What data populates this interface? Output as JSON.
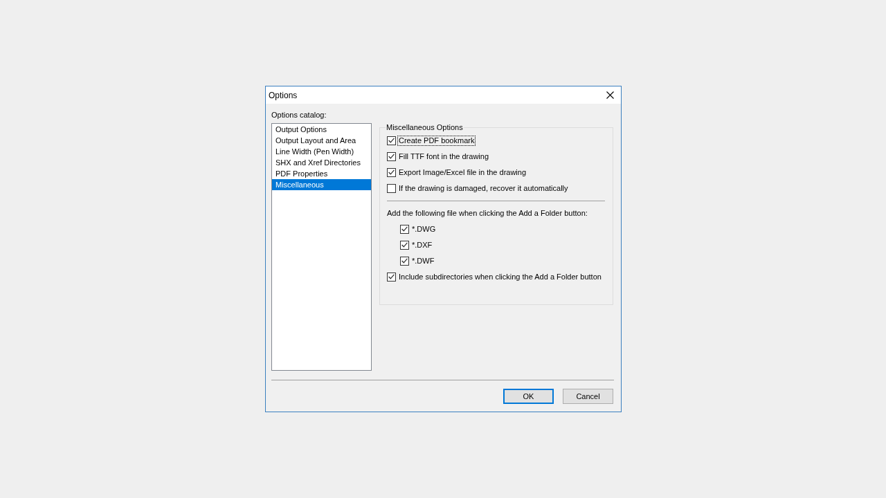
{
  "window": {
    "title": "Options"
  },
  "catalog": {
    "label": "Options catalog:",
    "items": [
      {
        "label": "Output Options",
        "selected": false
      },
      {
        "label": "Output Layout and Area",
        "selected": false
      },
      {
        "label": "Line Width (Pen Width)",
        "selected": false
      },
      {
        "label": "SHX and Xref Directories",
        "selected": false
      },
      {
        "label": "PDF Properties",
        "selected": false
      },
      {
        "label": "Miscellaneous",
        "selected": true
      }
    ]
  },
  "group": {
    "title": "Miscellaneous Options",
    "options": [
      {
        "label": "Create PDF bookmark",
        "checked": true,
        "focused": true
      },
      {
        "label": "Fill TTF font in the drawing",
        "checked": true,
        "focused": false
      },
      {
        "label": "Export Image/Excel file in the drawing",
        "checked": true,
        "focused": false
      },
      {
        "label": "If the drawing is damaged, recover it automatically",
        "checked": false,
        "focused": false
      }
    ],
    "file_types": {
      "label": "Add the following file when clicking the Add a Folder button:",
      "items": [
        {
          "label": "*.DWG",
          "checked": true
        },
        {
          "label": "*.DXF",
          "checked": true
        },
        {
          "label": "*.DWF",
          "checked": true
        }
      ]
    },
    "more_options": [
      {
        "label": "Include subdirectories when clicking the Add a Folder button",
        "checked": true,
        "focused": false
      }
    ]
  },
  "buttons": [
    {
      "label": "OK",
      "default": true
    },
    {
      "label": "Cancel",
      "default": false
    }
  ]
}
